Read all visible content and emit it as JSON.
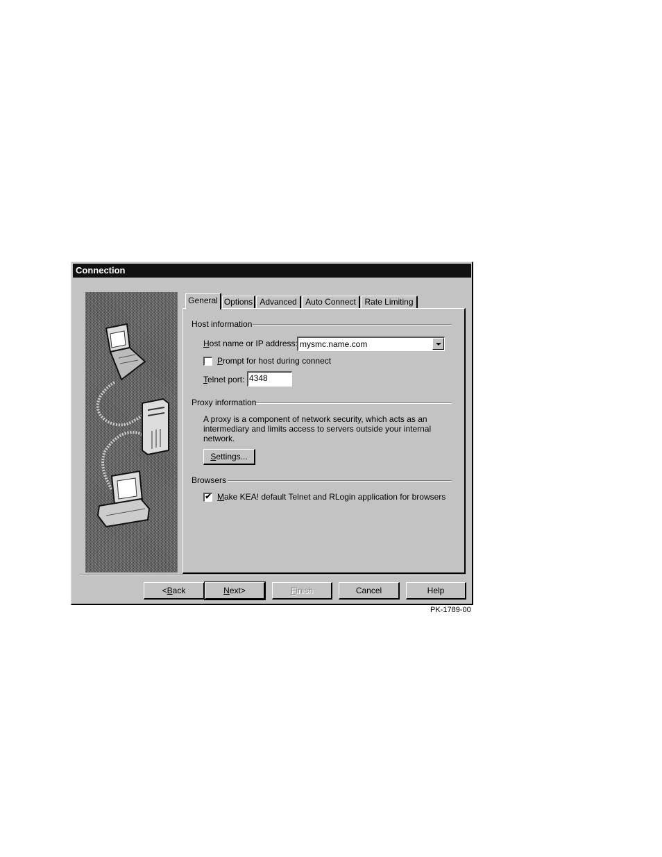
{
  "window": {
    "title": "Connection"
  },
  "tabs": [
    {
      "label": "General",
      "active": true
    },
    {
      "label": "Options",
      "active": false
    },
    {
      "label": "Advanced",
      "active": false
    },
    {
      "label": "Auto Connect",
      "active": false
    },
    {
      "label": "Rate Limiting",
      "active": false
    }
  ],
  "host_info": {
    "group_label": "Host information",
    "host_label_mnemonic": "H",
    "host_label_rest": "ost name or IP address:",
    "host_value": "mysmc.name.com",
    "prompt_label_mnemonic": "P",
    "prompt_label_rest": "rompt for host during connect",
    "prompt_checked": false,
    "telnet_label_mnemonic": "T",
    "telnet_label_rest": "elnet port:",
    "telnet_value": "4348"
  },
  "proxy_info": {
    "group_label": "Proxy information",
    "description": "A proxy is a component of network security, which acts as an intermediary and limits access to servers outside your internal network.",
    "settings_mnemonic": "S",
    "settings_rest": "ettings..."
  },
  "browsers": {
    "group_label": "Browsers",
    "default_mnemonic": "M",
    "default_rest": "ake KEA! default Telnet and RLogin application for browsers",
    "default_checked": true,
    "check_glyph": "✔"
  },
  "buttons": {
    "back_pre": "<",
    "back_mnemonic": "B",
    "back_rest": "ack",
    "next_mnemonic": "N",
    "next_rest": "ext>",
    "finish_mnemonic": "F",
    "finish_rest": "inish",
    "cancel": "Cancel",
    "help": "Help"
  },
  "figure_id": "PK-1789-00"
}
